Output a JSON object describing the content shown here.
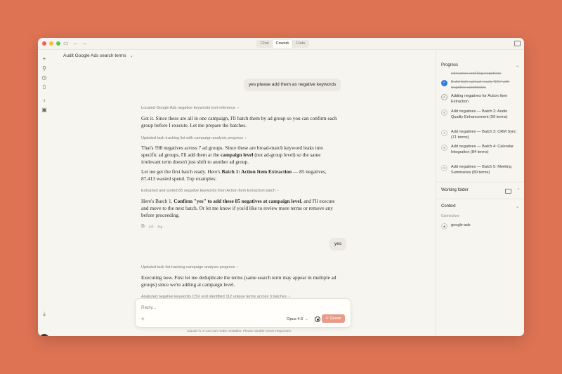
{
  "window": {
    "mode_tabs": [
      "Chat",
      "Cowork",
      "Code"
    ],
    "active_mode": "Cowork"
  },
  "chat": {
    "title": "Audit Google Ads search terms",
    "user_msg_1": "yes please add them as negative keywords",
    "action_1": "Located Google Ads negative keywords tool reference",
    "para_1": "Got it. Since these are all in one campaign, I'll batch them by ad group so you can confirm each group before I execute. Let me prepare the batches.",
    "action_2": "Updated task tracking list with campaign analysis progress",
    "para_2_a": "That's 598 negatives across 7 ad groups. Since these are broad-match keyword leaks into specific ad groups, I'll add them at the ",
    "para_2_bold": "campaign level",
    "para_2_b": " (not ad-group level) so the same irrelevant term doesn't just shift to another ad group.",
    "para_3_a": "Let me get the first batch ready. Here's ",
    "para_3_bold": "Batch 1: Action Item Extraction",
    "para_3_b": " — 85 negatives, 87,413 wasted spend. Top examples:",
    "action_3": "Extracted and sorted 85 negative keywords from Action Item Extraction batch",
    "para_4_a": "Here's Batch 1. ",
    "para_4_bold": "Confirm \"yes\" to add these 85 negatives at campaign level",
    "para_4_b": ", and I'll execute and move to the next batch. Or let me know if you'd like to review more terms or remove any before proceeding.",
    "user_msg_2": "yes",
    "action_4": "Updated task list tracking campaign analysis progress",
    "para_5": "Executing now. First let me deduplicate the terms (same search term may appear in multiple ad groups) since we're adding at campaign level.",
    "action_5": "Analyzed negative keywords CSV and identified 112 unique terms across 3 batches"
  },
  "composer": {
    "placeholder": "Reply...",
    "model": "Opus 4.6",
    "queue_label": "Queue",
    "disclaimer": "Claude is AI and can make mistakes. Please double-check responses."
  },
  "user": {
    "initials": "AL"
  },
  "progress": {
    "title": "Progress",
    "steps": [
      {
        "num": "",
        "label": "relevance and flag negatives",
        "status": "done"
      },
      {
        "num": "✓",
        "label": "Build bulk-upload-ready CSV with negative candidates",
        "status": "done"
      },
      {
        "num": "6",
        "label": "Adding negatives for Action Item Extraction",
        "status": "current"
      },
      {
        "num": "6",
        "label": "Add negatives — Batch 2: Audio Quality Enhancement (99 terms)",
        "status": "pending"
      },
      {
        "num": "7",
        "label": "Add negatives — Batch 3: CRM Sync (71 terms)",
        "status": "pending"
      },
      {
        "num": "8",
        "label": "Add negatives — Batch 4: Calendar Integration (84 terms)",
        "status": "pending"
      },
      {
        "num": "9",
        "label": "Add negatives — Batch 5: Meeting Summaries (80 terms)",
        "status": "pending"
      }
    ]
  },
  "working_folder": {
    "title": "Working folder"
  },
  "context": {
    "title": "Context",
    "connectors_label": "Connectors",
    "connectors": [
      "google-ads"
    ]
  },
  "icons": {
    "new": "plus-icon",
    "search": "search-icon",
    "history": "clock-icon",
    "files": "file-icon",
    "ideas": "lightbulb-icon",
    "tools": "briefcase-icon",
    "download": "download-icon"
  }
}
